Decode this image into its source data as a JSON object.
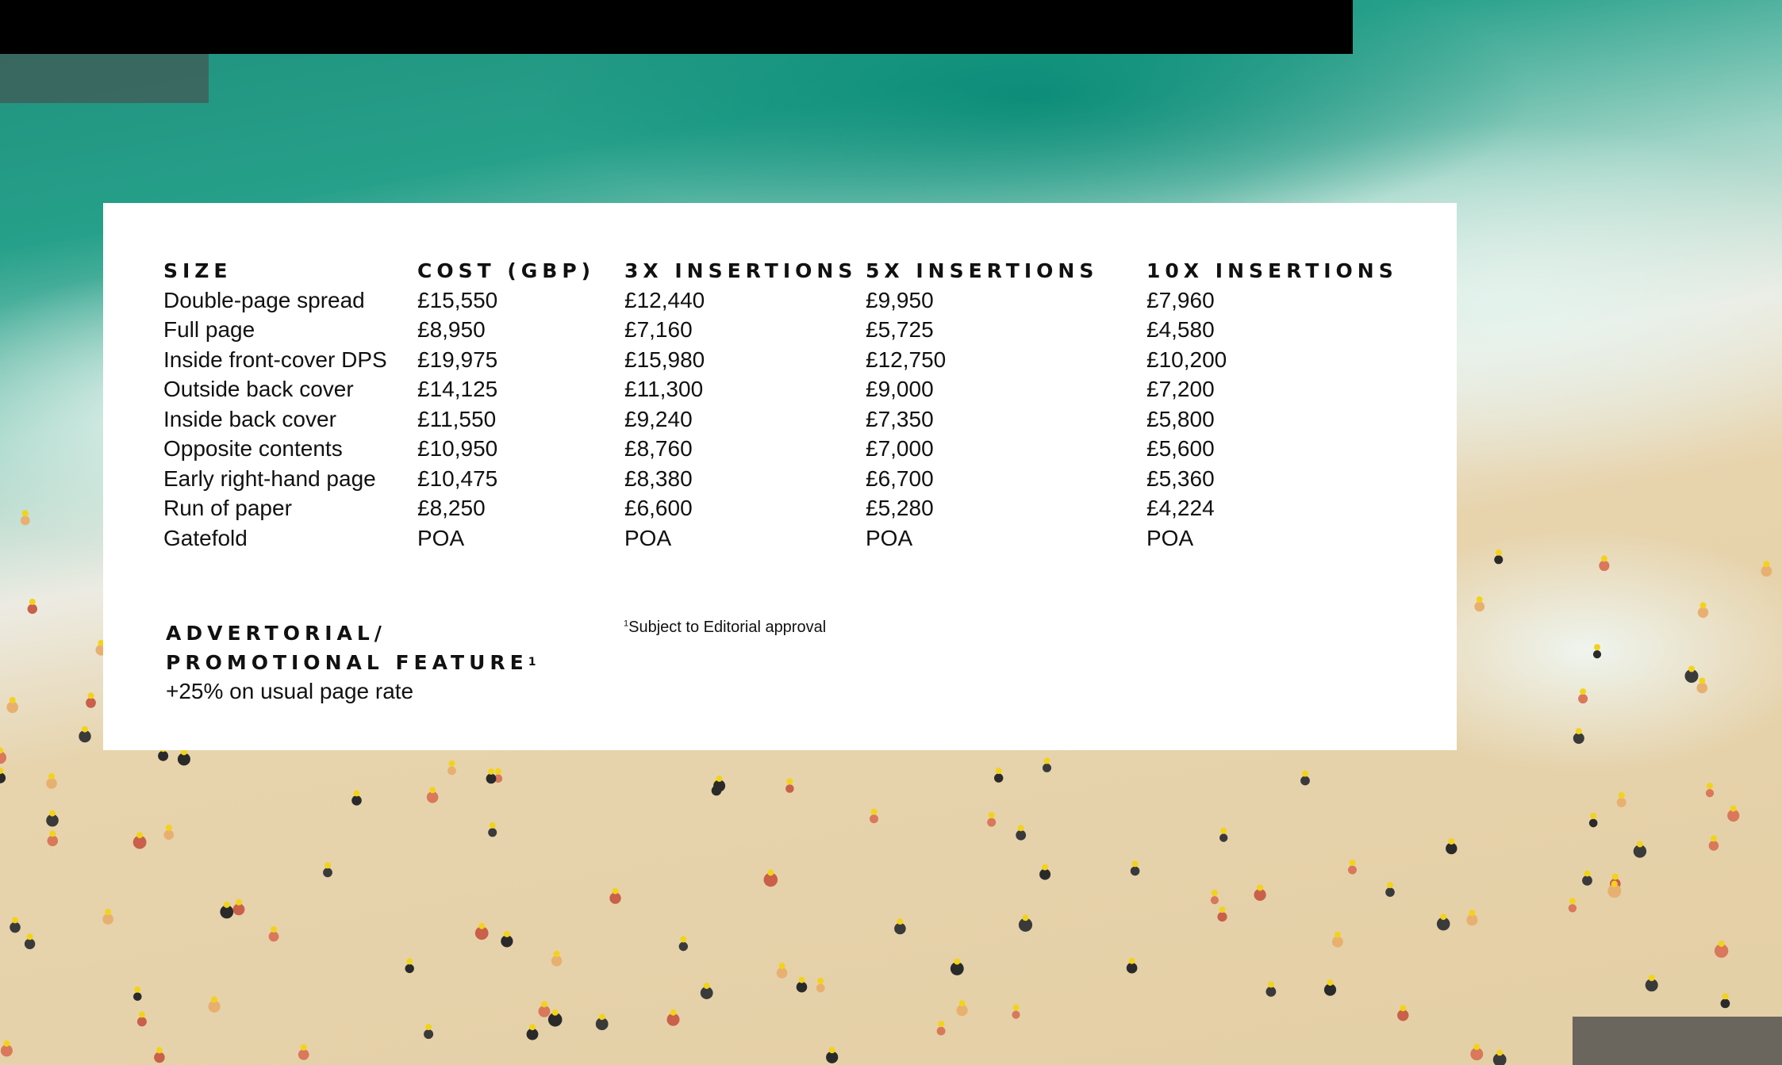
{
  "colors": {
    "panel": "#ffffff",
    "top_bar": "#000000",
    "sea": "#1f8f7c",
    "sand": "#e4cfa6"
  },
  "table": {
    "headers": [
      "SIZE",
      "COST (GBP)",
      "3X INSERTIONS",
      "5X INSERTIONS",
      "10X INSERTIONS"
    ],
    "rows": [
      [
        "Double-page spread",
        "£15,550",
        "£12,440",
        "£9,950",
        "£7,960"
      ],
      [
        "Full page",
        "£8,950",
        "£7,160",
        "£5,725",
        "£4,580"
      ],
      [
        "Inside front-cover DPS",
        "£19,975",
        "£15,980",
        "£12,750",
        "£10,200"
      ],
      [
        "Outside back cover",
        "£14,125",
        "£11,300",
        "£9,000",
        "£7,200"
      ],
      [
        "Inside back cover",
        "£11,550",
        "£9,240",
        "£7,350",
        "£5,800"
      ],
      [
        "Opposite contents",
        "£10,950",
        "£8,760",
        "£7,000",
        "£5,600"
      ],
      [
        "Early right-hand page",
        "£10,475",
        "£8,380",
        "£6,700",
        "£5,360"
      ],
      [
        "Run of paper",
        "£8,250",
        "£6,600",
        "£5,280",
        "£4,224"
      ],
      [
        "Gatefold",
        "POA",
        "POA",
        "POA",
        "POA"
      ]
    ]
  },
  "advertorial": {
    "title_line1": "ADVERTORIAL/",
    "title_line2": "PROMOTIONAL FEATURE",
    "title_sup": "1",
    "note": "+25% on usual page rate"
  },
  "footnote": {
    "sup": "1",
    "text": "Subject to Editorial approval"
  }
}
